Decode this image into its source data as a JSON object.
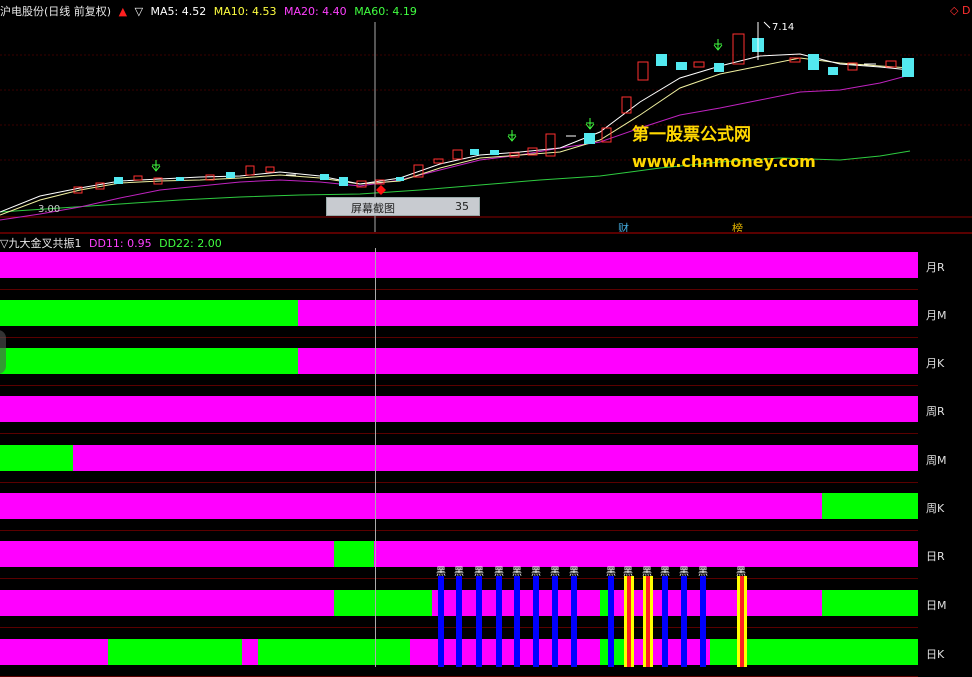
{
  "header": {
    "title": "沪电股份(日线 前复权)",
    "up_arrow": "▲",
    "down_arrow": "▽",
    "ma5": "MA5: 4.52",
    "ma10": "MA10: 4.53",
    "ma20": "MA20: 4.40",
    "ma60": "MA60: 4.19",
    "right_mark": "◇ D"
  },
  "chart_labels": {
    "high_price": "7.14",
    "low_price": "3.00",
    "event_1": "财",
    "event_2": "榜"
  },
  "tooltip": {
    "label": "屏幕截图",
    "value": "35"
  },
  "watermark": {
    "line1": "第一股票公式网",
    "line2": "www.chnmoney.com"
  },
  "indicator": {
    "title": "▽九大金叉共振1",
    "dd11": "DD11: 0.95",
    "dd22": "DD22: 2.00"
  },
  "rows": [
    {
      "label": "月R",
      "segments": [
        [
          "m",
          0,
          918
        ]
      ]
    },
    {
      "label": "月M",
      "segments": [
        [
          "g",
          0,
          298
        ],
        [
          "m",
          298,
          918
        ]
      ]
    },
    {
      "label": "月K",
      "segments": [
        [
          "g",
          0,
          298
        ],
        [
          "m",
          298,
          918
        ]
      ]
    },
    {
      "label": "周R",
      "segments": [
        [
          "m",
          0,
          918
        ]
      ]
    },
    {
      "label": "周M",
      "segments": [
        [
          "g",
          0,
          73
        ],
        [
          "m",
          73,
          918
        ]
      ]
    },
    {
      "label": "周K",
      "segments": [
        [
          "m",
          0,
          822
        ],
        [
          "g",
          822,
          918
        ]
      ]
    },
    {
      "label": "日R",
      "segments": [
        [
          "m",
          0,
          334
        ],
        [
          "g",
          334,
          374
        ],
        [
          "m",
          374,
          918
        ]
      ]
    },
    {
      "label": "日M",
      "segments": [
        [
          "m",
          0,
          334
        ],
        [
          "g",
          334,
          432
        ],
        [
          "m",
          432,
          600
        ],
        [
          "g",
          600,
          610
        ],
        [
          "m",
          610,
          822
        ],
        [
          "g",
          822,
          918
        ]
      ]
    },
    {
      "label": "日K",
      "segments": [
        [
          "m",
          0,
          108
        ],
        [
          "g",
          108,
          242
        ],
        [
          "m",
          242,
          258
        ],
        [
          "g",
          258,
          410
        ],
        [
          "m",
          410,
          600
        ],
        [
          "g",
          600,
          625
        ],
        [
          "m",
          625,
          710
        ],
        [
          "g",
          710,
          918
        ]
      ]
    }
  ],
  "black_label": "黑",
  "colors": {
    "magenta": "#ff00ff",
    "green": "#00ff00",
    "blue": "#0000ff",
    "yellow": "#ffff00",
    "red": "#ff2020"
  }
}
